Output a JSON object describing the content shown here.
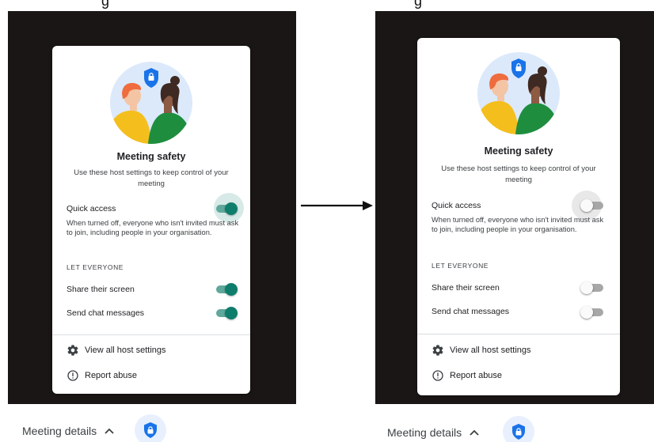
{
  "colors": {
    "toggle_on": "#0f7d6b",
    "toggle_on_track": "#5fa89b",
    "toggle_off_track": "#a7a7a7",
    "shield_blue": "#1a73e8",
    "dark_background": "#1b1616"
  },
  "panels": [
    {
      "state": "before",
      "header_fragment": "g",
      "title": "Meeting safety",
      "subtitle": "Use these host settings to keep control of your meeting",
      "quick_access": {
        "label": "Quick access",
        "description": "When turned off, everyone who isn't invited must ask to join, including people in your organisation.",
        "enabled": true
      },
      "section_heading": "LET EVERYONE",
      "toggles": [
        {
          "label": "Share their screen",
          "enabled": true
        },
        {
          "label": "Send chat messages",
          "enabled": true
        }
      ],
      "footer": [
        {
          "icon": "gear-icon",
          "label": "View all host settings"
        },
        {
          "icon": "alert-circle-icon",
          "label": "Report abuse"
        }
      ],
      "bottom_bar": {
        "label": "Meeting details",
        "icon": "shield-lock-icon"
      }
    },
    {
      "state": "after",
      "header_fragment": "g",
      "title": "Meeting safety",
      "subtitle": "Use these host settings to keep control of your meeting",
      "quick_access": {
        "label": "Quick access",
        "description": "When turned off, everyone who isn't invited must ask to join, including people in your organisation.",
        "enabled": false
      },
      "section_heading": "LET EVERYONE",
      "toggles": [
        {
          "label": "Share their screen",
          "enabled": false
        },
        {
          "label": "Send chat messages",
          "enabled": false
        }
      ],
      "footer": [
        {
          "icon": "gear-icon",
          "label": "View all host settings"
        },
        {
          "icon": "alert-circle-icon",
          "label": "Report abuse"
        }
      ],
      "bottom_bar": {
        "label": "Meeting details",
        "icon": "shield-lock-icon"
      }
    }
  ],
  "transition_arrow": "right-arrow-icon"
}
